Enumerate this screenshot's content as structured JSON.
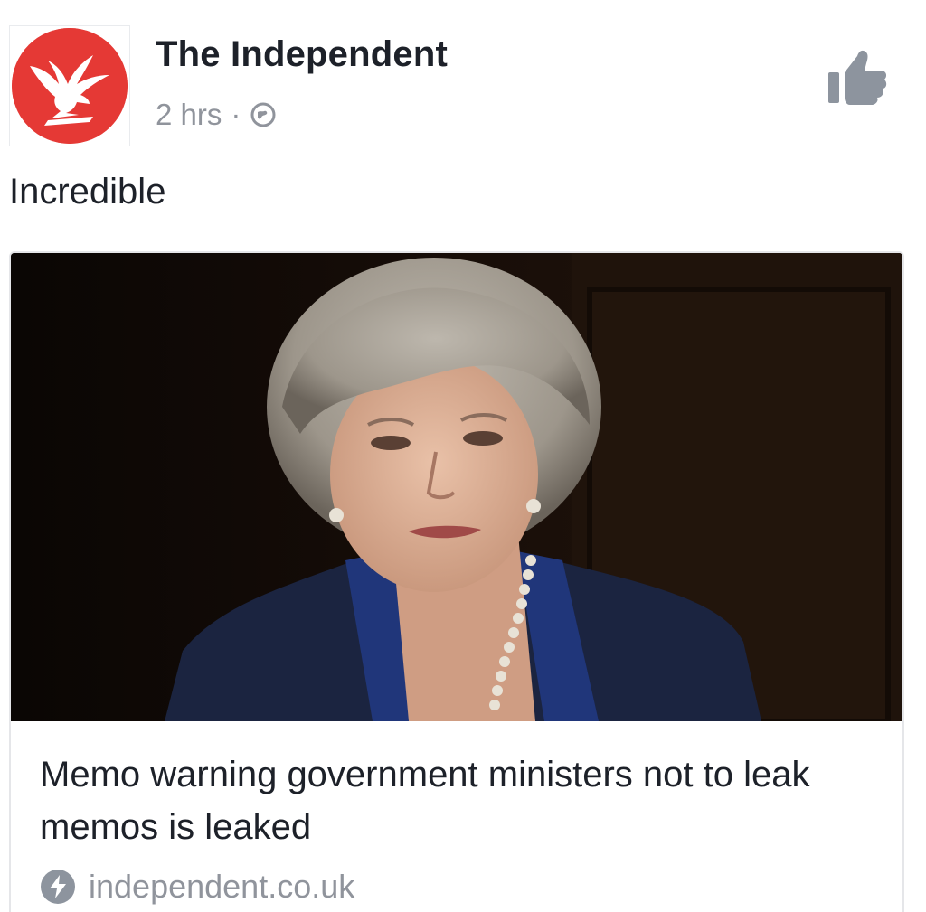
{
  "post": {
    "page_name": "The Independent",
    "timestamp": "2 hrs",
    "separator": "·",
    "privacy_icon": "globe-icon",
    "text": "Incredible",
    "like_icon": "thumbs-up-icon"
  },
  "link_card": {
    "image_alt": "photo-of-woman-in-navy-jacket",
    "title": "Memo warning government ministers not to leak memos is leaked",
    "domain": "independent.co.uk",
    "domain_icon": "bolt-icon"
  },
  "colors": {
    "brand_red": "#e53935",
    "text_primary": "#1d2129",
    "text_secondary": "#90949c",
    "icon_gray": "#8d949e"
  }
}
